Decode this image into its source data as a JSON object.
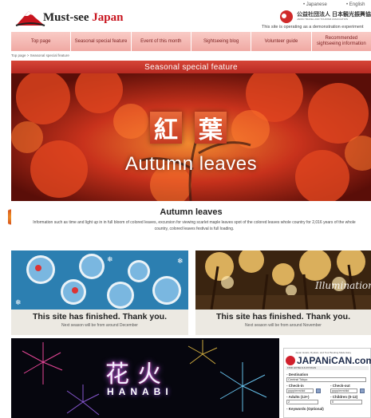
{
  "header": {
    "logo_prefix": "Must-see ",
    "logo_accent": "Japan",
    "lang_ja": "• Japanese",
    "lang_en": "• English",
    "org_name": "公益社団法人 日本観光振興協会",
    "org_sub": "JAPAN TRAVEL AND TOURISM ASSOCIATION",
    "demo_note": "This site is operating as a demonstration experiment"
  },
  "nav": {
    "items": [
      "Top page",
      "Seasonal special feature",
      "Event of this month",
      "Sightseeing blog",
      "Volunteer guide",
      "Recommended sightseeing information"
    ]
  },
  "breadcrumb": "Top page  >  Seasonal special feature",
  "section_title": "Seasonal special feature",
  "hero": {
    "kanji_1": "紅",
    "kanji_2": "葉",
    "english": "Autumn leaves"
  },
  "feature": {
    "title": "Autumn leaves",
    "body": "Information such as time and light up in in full bloom of colored leaves, excursion for viewing scarlet maple leaves spot of the colored leaves whole country for 2,016 years of the whole country, colored leaves festival is full loading."
  },
  "tiles": [
    {
      "title": "This site has finished. Thank you.",
      "subtitle": "Next season will be from around December"
    },
    {
      "title": "This site has finished. Thank you.",
      "subtitle": "Next season will be from around November"
    }
  ],
  "tile_right_overlay": "Illumination",
  "fireworks": {
    "kanji": "花火",
    "roman": "HANABI"
  },
  "booking": {
    "tagline": "Japan Hotels, Ryokan, and Tour Booking Made Easy",
    "logo": "JAPANiCAN.com",
    "tab": "FIND HOTELS & RYOKAN",
    "destination_label": "- Destination",
    "destination_value": "Central Tokyo",
    "checkin_label": "- Check-in",
    "checkin_value": "yyyy/mm/dd",
    "checkout_label": "- Check-out",
    "checkout_value": "yyyy/mm/dd",
    "adults_label": "- Adults (13+)",
    "adults_value": "2",
    "children_label": "- Children (0-12)",
    "children_value": "0",
    "keywords_label": "- Keywords (Optional)"
  }
}
